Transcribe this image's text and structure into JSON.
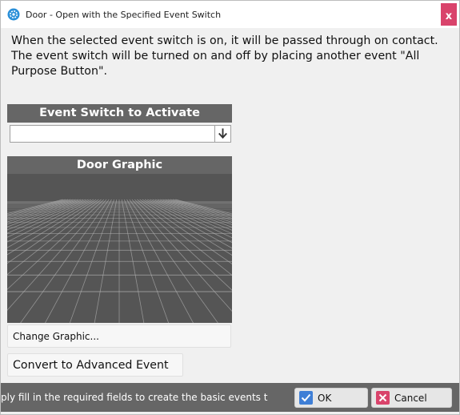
{
  "window": {
    "title": "Door - Open with the Specified Event Switch",
    "close_glyph": "x"
  },
  "description": {
    "line1": "When the selected event switch is on, it will be passed through on contact.",
    "line2": "The event switch will be turned on and off by placing another event \"All Purpose Button\"."
  },
  "event_switch": {
    "header": "Event Switch to Activate",
    "selected_value": ""
  },
  "door_graphic": {
    "header": "Door Graphic",
    "change_label": "Change Graphic..."
  },
  "convert_label": "Convert to Advanced Event",
  "footer": {
    "hint": "ply fill in the required fields to create the basic events t",
    "ok_label": "OK",
    "cancel_label": "Cancel"
  },
  "colors": {
    "header_bg": "#666666",
    "close_bg": "#d9436b",
    "ok_icon": "#3f7fd6",
    "cancel_icon": "#d9436b"
  },
  "icons": {
    "app": "gear-app-icon",
    "combo": "arrow-down-icon",
    "ok": "checkmark-icon",
    "cancel": "x-icon"
  }
}
